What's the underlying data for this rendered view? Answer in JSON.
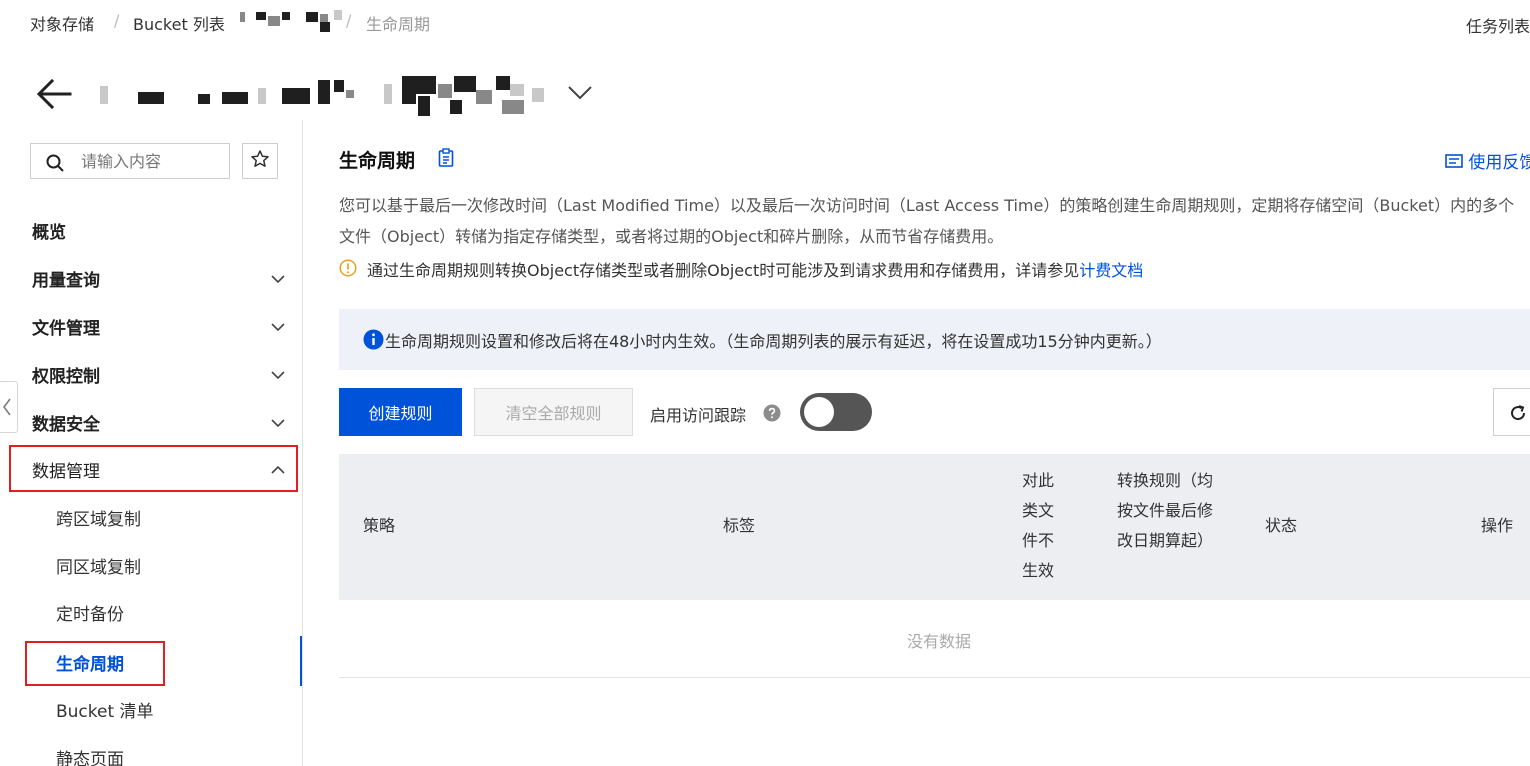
{
  "breadcrumb": {
    "items": [
      "对象存储",
      "Bucket 列表",
      "生命周期"
    ],
    "separator": "/"
  },
  "header": {
    "task_list": "任务列表"
  },
  "sidebar": {
    "search_placeholder": "请输入内容",
    "items": [
      {
        "label": "概览"
      },
      {
        "label": "用量查询"
      },
      {
        "label": "文件管理"
      },
      {
        "label": "权限控制"
      },
      {
        "label": "数据安全"
      },
      {
        "label": "数据管理"
      }
    ],
    "sub_items": [
      {
        "label": "跨区域复制"
      },
      {
        "label": "同区域复制"
      },
      {
        "label": "定时备份"
      },
      {
        "label": "生命周期"
      },
      {
        "label": "Bucket 清单"
      },
      {
        "label": "静态页面"
      }
    ]
  },
  "main": {
    "title": "生命周期",
    "feedback": "使用反馈",
    "description": "您可以基于最后一次修改时间（Last Modified Time）以及最后一次访问时间（Last Access Time）的策略创建生命周期规则，定期将存储空间（Bucket）内的多个文件（Object）转储为指定存储类型，或者将过期的Object和碎片删除，从而节省存储费用。",
    "warning_text": "通过生命周期规则转换Object存储类型或者删除Object时可能涉及到请求费用和存储费用，详请参见",
    "warning_link": "计费文档",
    "info_banner": "生命周期规则设置和修改后将在48小时内生效。（生命周期列表的展示有延迟，将在设置成功15分钟内更新。）",
    "toolbar": {
      "create_label": "创建规则",
      "clear_label": "清空全部规则",
      "tracking_label": "启用访问跟踪",
      "tracking_enabled": false
    },
    "table": {
      "columns": {
        "policy": "策略",
        "tags": "标签",
        "not_effective": "对此类文件不生效",
        "transition": "转换规则（均按文件最后修改日期算起）",
        "status": "状态",
        "actions": "操作"
      },
      "empty_text": "没有数据"
    }
  },
  "colors": {
    "primary": "#0052d9",
    "highlight_box": "#e02020",
    "banner_bg": "#eef1f7",
    "table_header_bg": "#eceef2"
  }
}
